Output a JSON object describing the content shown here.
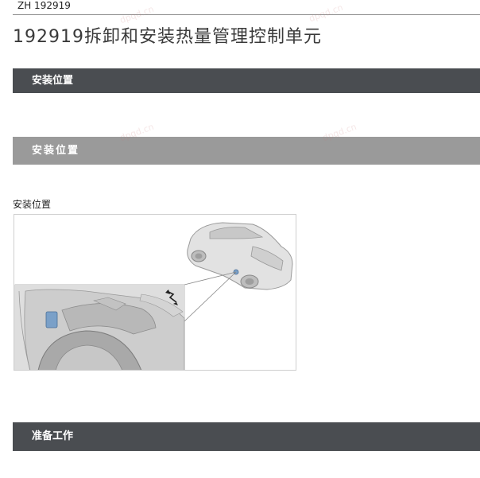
{
  "header": {
    "doc_code": "ZH  192919",
    "title": "192919拆卸和安装热量管理控制单元"
  },
  "sections": {
    "install_location_bar": "安装位置",
    "install_location_sub_bar": "安装位置",
    "preparation_bar": "准备工作"
  },
  "figure": {
    "caption": "安装位置",
    "detail_icon": "rotate-arrow-icon",
    "vehicle_color": "#d9d9d9",
    "highlight_color": "#7aa0c8"
  },
  "watermark_text": "dpqd.cn"
}
